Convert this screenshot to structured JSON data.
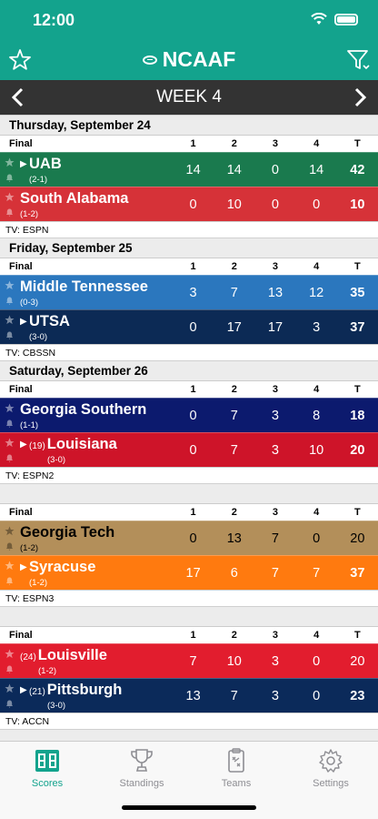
{
  "status_bar": {
    "time": "12:00"
  },
  "header": {
    "title": "NCAAF"
  },
  "week_nav": {
    "title": "WEEK 4"
  },
  "col_headers": {
    "status": "Final",
    "q1": "1",
    "q2": "2",
    "q3": "3",
    "q4": "4",
    "total": "T"
  },
  "games": [
    {
      "day": "Thursday, September 24",
      "status": "Final",
      "tv": "TV: ESPN",
      "teams": [
        {
          "name": "UAB",
          "rank": "",
          "record": "(2-1)",
          "possession": true,
          "color": "#1a7a4e",
          "q1": "14",
          "q2": "14",
          "q3": "0",
          "q4": "14",
          "total": "42"
        },
        {
          "name": "South Alabama",
          "rank": "",
          "record": "(1-2)",
          "possession": false,
          "color": "#d63238",
          "q1": "0",
          "q2": "10",
          "q3": "0",
          "q4": "0",
          "total": "10"
        }
      ]
    },
    {
      "day": "Friday, September 25",
      "status": "Final",
      "tv": "TV: CBSSN",
      "teams": [
        {
          "name": "Middle Tennessee",
          "rank": "",
          "record": "(0-3)",
          "possession": false,
          "color": "#2b77be",
          "q1": "3",
          "q2": "7",
          "q3": "13",
          "q4": "12",
          "total": "35"
        },
        {
          "name": "UTSA",
          "rank": "",
          "record": "(3-0)",
          "possession": true,
          "color": "#0c2a55",
          "q1": "0",
          "q2": "17",
          "q3": "17",
          "q4": "3",
          "total": "37"
        }
      ]
    },
    {
      "day": "Saturday, September 26",
      "status": "Final",
      "tv": "TV: ESPN2",
      "teams": [
        {
          "name": "Georgia Southern",
          "rank": "",
          "record": "(1-1)",
          "possession": false,
          "color": "#0c1a6e",
          "q1": "0",
          "q2": "7",
          "q3": "3",
          "q4": "8",
          "total": "18"
        },
        {
          "name": "Louisiana",
          "rank": "(19)",
          "record": "(3-0)",
          "possession": true,
          "color": "#ce1429",
          "q1": "0",
          "q2": "7",
          "q3": "3",
          "q4": "10",
          "total": "20"
        }
      ]
    },
    {
      "day": "",
      "status": "Final",
      "tv": "TV: ESPN3",
      "teams": [
        {
          "name": "Georgia Tech",
          "rank": "",
          "record": "(1-2)",
          "possession": false,
          "color": "#b38f5a",
          "q1": "0",
          "q2": "13",
          "q3": "7",
          "q4": "0",
          "total": "20"
        },
        {
          "name": "Syracuse",
          "rank": "",
          "record": "(1-2)",
          "possession": true,
          "color": "#ff7a0f",
          "q1": "17",
          "q2": "6",
          "q3": "7",
          "q4": "7",
          "total": "37"
        }
      ]
    },
    {
      "day": "",
      "status": "Final",
      "tv": "TV: ACCN",
      "teams": [
        {
          "name": "Louisville",
          "rank": "(24)",
          "record": "(1-2)",
          "possession": false,
          "color": "#e21d2e",
          "q1": "7",
          "q2": "10",
          "q3": "3",
          "q4": "0",
          "total": "20"
        },
        {
          "name": "Pittsburgh",
          "rank": "(21)",
          "record": "(3-0)",
          "possession": true,
          "color": "#0b2a5a",
          "q1": "13",
          "q2": "7",
          "q3": "3",
          "q4": "0",
          "total": "23"
        }
      ]
    }
  ],
  "tabs": [
    {
      "label": "Scores",
      "icon": "scoreboard-icon",
      "active": true
    },
    {
      "label": "Standings",
      "icon": "trophy-icon",
      "active": false
    },
    {
      "label": "Teams",
      "icon": "clipboard-icon",
      "active": false
    },
    {
      "label": "Settings",
      "icon": "gear-icon",
      "active": false
    }
  ],
  "colors": {
    "brand": "#13a38d",
    "week_bar": "#333333",
    "tab_active": "#13a38d",
    "tab_inactive": "#8e8e93"
  }
}
